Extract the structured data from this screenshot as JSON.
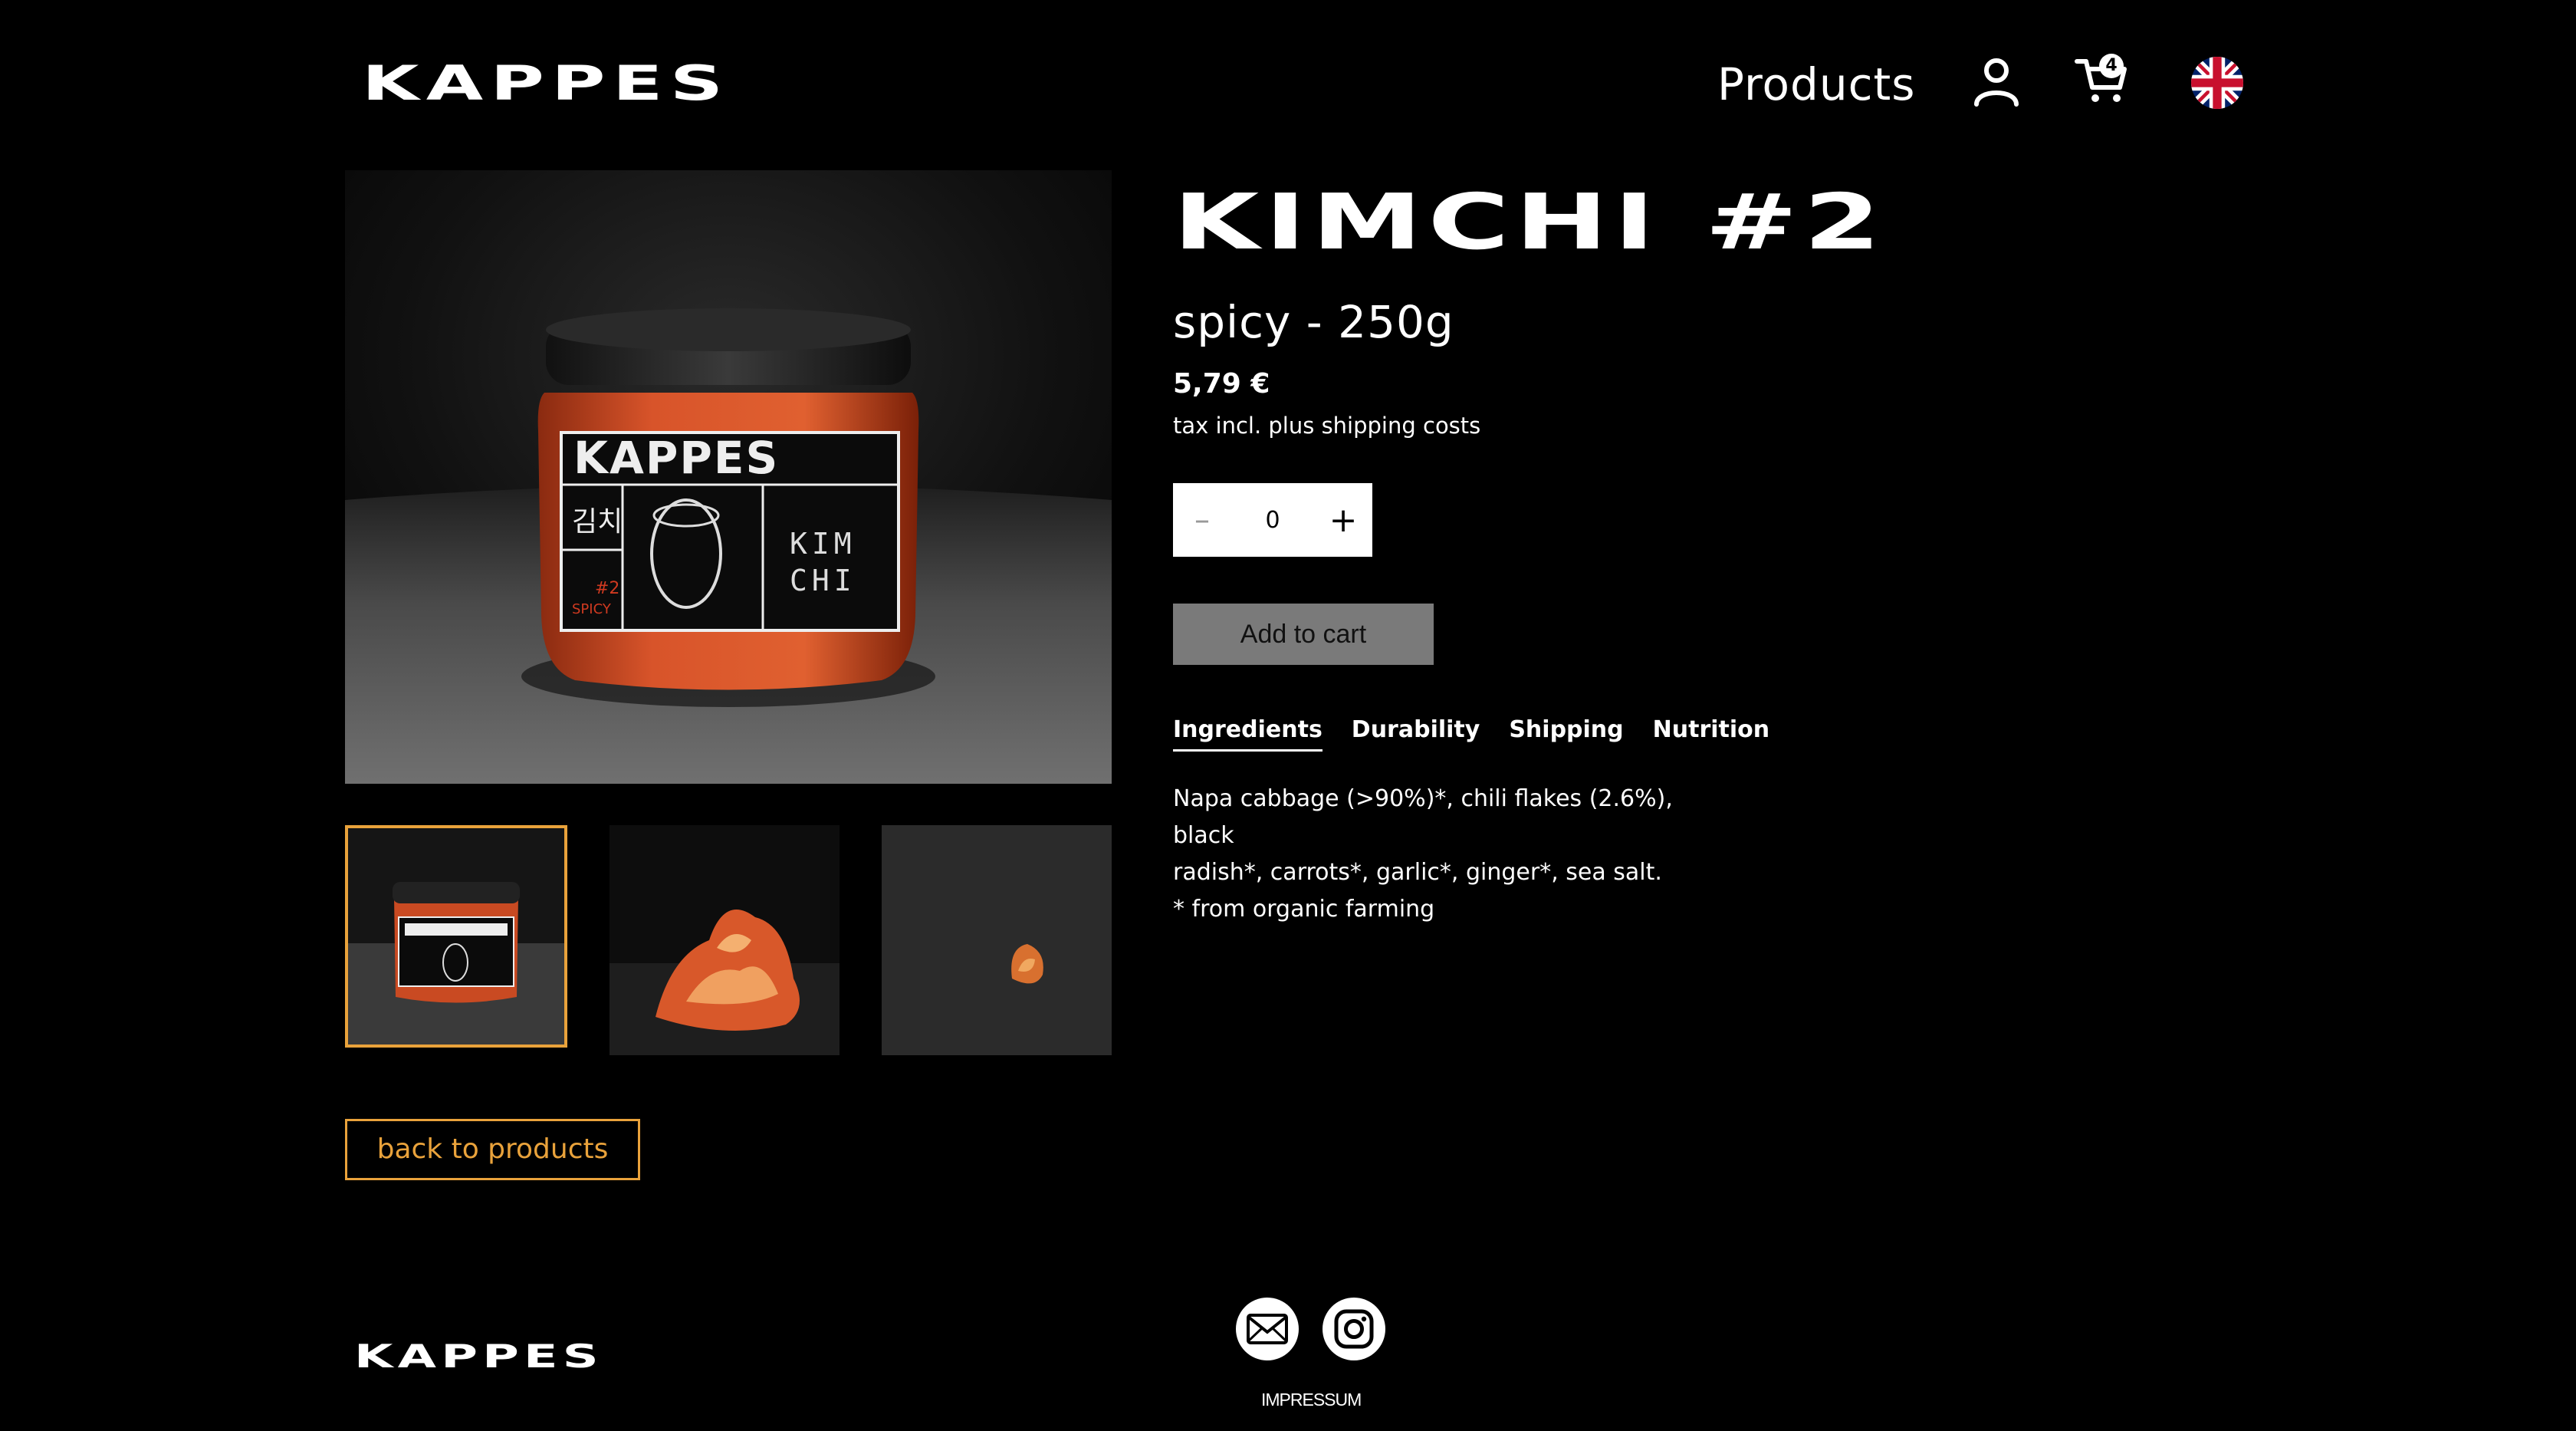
{
  "header": {
    "logo": "KAPPES",
    "nav_products": "Products",
    "cart_count": "4",
    "user_icon": "user-icon",
    "cart_icon": "cart-icon",
    "language_icon": "uk-flag-icon"
  },
  "product": {
    "title": "KIMCHI #2",
    "subtitle": "spicy - 250g",
    "price": "5,79 €",
    "tax_note": "tax incl. plus shipping costs",
    "quantity": "0",
    "add_to_cart": "Add to cart",
    "jar_label": {
      "brand": "KAPPES",
      "korean": "김치",
      "number": "#2",
      "variant": "SPICY",
      "kim": "KIM",
      "chi": "CHI"
    }
  },
  "tabs": [
    {
      "label": "Ingredients",
      "active": true
    },
    {
      "label": "Durability",
      "active": false
    },
    {
      "label": "Shipping",
      "active": false
    },
    {
      "label": "Nutrition",
      "active": false
    }
  ],
  "ingredients": {
    "line1": "Napa cabbage (>90%)*, chili flakes (2.6%), black",
    "line2": "radish*, carrots*, garlic*, ginger*, sea salt.",
    "line3": "* from organic farming"
  },
  "back_button": "back to products",
  "footer": {
    "logo": "KAPPES",
    "mail_icon": "mail-icon",
    "instagram_icon": "instagram-icon",
    "impressum": "IMPRESSUM"
  },
  "colors": {
    "background": "#000000",
    "accent": "#e9a23b",
    "button_gray": "#7a7a7a"
  }
}
